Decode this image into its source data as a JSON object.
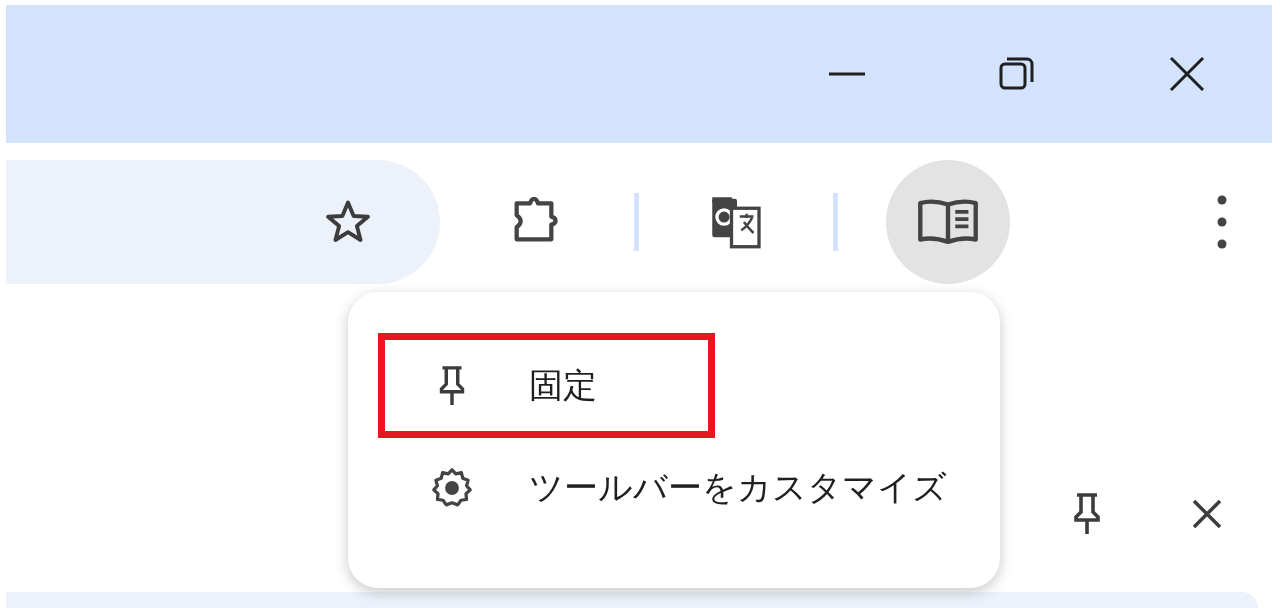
{
  "toolbar": {
    "reading_mode_button": {
      "active": true
    }
  },
  "context_menu": {
    "items": [
      {
        "kind": "pin",
        "label": "固定",
        "highlighted": true
      },
      {
        "kind": "customize",
        "label": "ツールバーをカスタマイズ",
        "highlighted": false
      }
    ]
  }
}
